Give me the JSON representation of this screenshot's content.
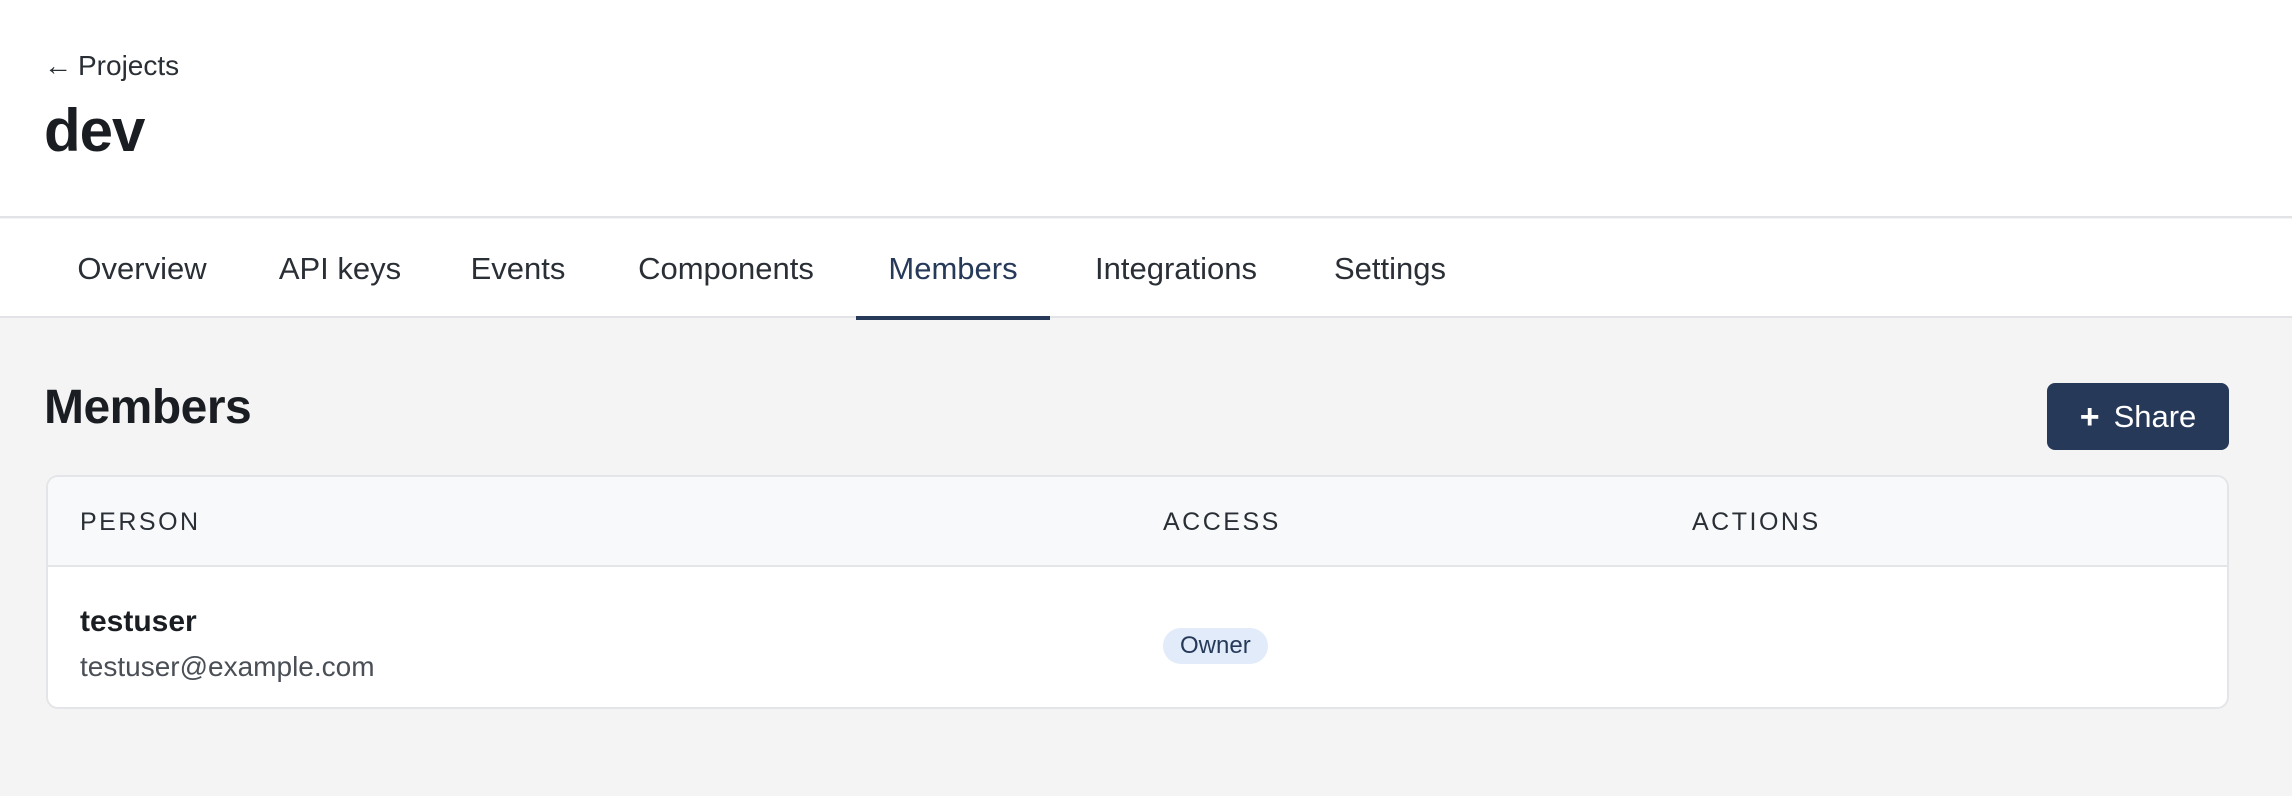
{
  "header": {
    "back_label": "Projects",
    "back_icon": "arrow-left-icon",
    "title": "dev"
  },
  "tabs": [
    {
      "label": "Overview",
      "active": false
    },
    {
      "label": "API keys",
      "active": false
    },
    {
      "label": "Events",
      "active": false
    },
    {
      "label": "Components",
      "active": false
    },
    {
      "label": "Members",
      "active": true
    },
    {
      "label": "Integrations",
      "active": false
    },
    {
      "label": "Settings",
      "active": false
    }
  ],
  "members": {
    "title": "Members",
    "share_label": "Share",
    "share_icon": "plus-icon",
    "columns": [
      "PERSON",
      "ACCESS",
      "ACTIONS"
    ],
    "rows": [
      {
        "name": "testuser",
        "email": "testuser@example.com",
        "access": "Owner"
      }
    ]
  },
  "colors": {
    "accent": "#263959",
    "badge_bg": "#e1ebf9",
    "page_bg": "#f4f4f4"
  }
}
